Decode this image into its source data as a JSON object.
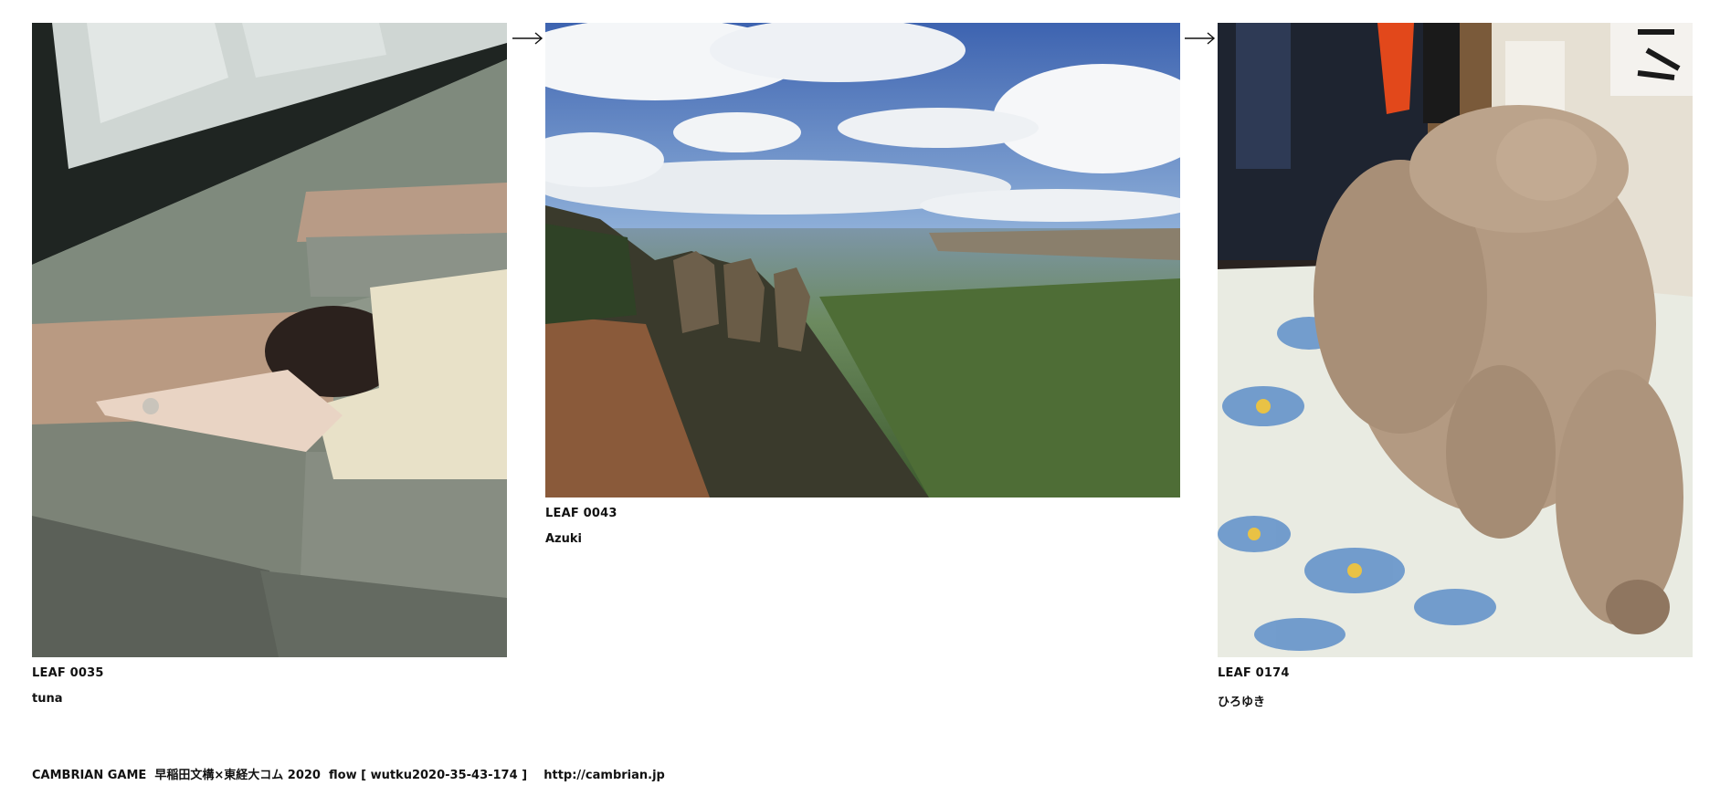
{
  "leaves": [
    {
      "id_label": "LEAF 0035",
      "name": "tuna",
      "image": "classroom-sleeping-photo"
    },
    {
      "id_label": "LEAF 0043",
      "name": "Azuki",
      "image": "blue-mountains-landscape-photo"
    },
    {
      "id_label": "LEAF 0174",
      "name": "ひろゆき",
      "image": "poodle-photo"
    }
  ],
  "arrows": [
    "arrow-right-icon",
    "arrow-right-icon"
  ],
  "footer": {
    "text": "CAMBRIAN GAME  早稲田文構×東経大コム 2020  flow [ wutku2020-35-43-174 ]",
    "link": "http://cambrian.jp"
  }
}
